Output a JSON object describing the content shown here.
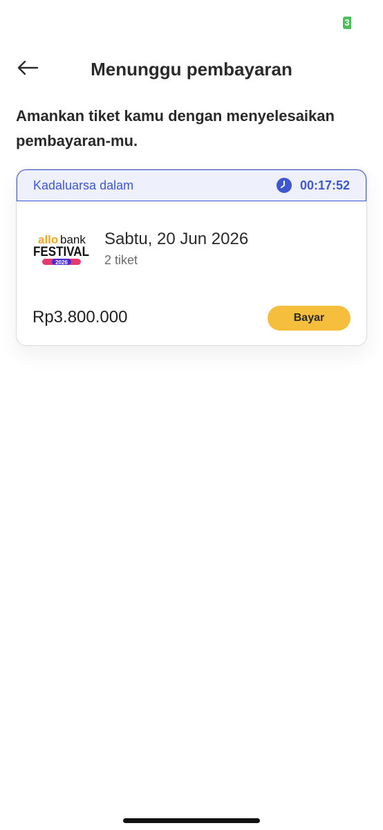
{
  "status_bar": {
    "battery_level": "3",
    "battery_color": "#4cbf5a"
  },
  "header": {
    "title": "Menunggu pembayaran",
    "back_icon": "arrow-left-icon"
  },
  "intro": {
    "text": "Amankan tiket kamu dengan menyelesaikan pembayaran-mu."
  },
  "order_card": {
    "expiry": {
      "label": "Kadaluarsa dalam",
      "countdown": "00:17:52",
      "icon": "clock-icon",
      "color": "#3e57d0"
    },
    "event": {
      "logo": {
        "line1": "allobank",
        "line2": "FESTIVAL",
        "year": "2026"
      },
      "date": "Sabtu, 20 Jun 2026",
      "ticket_count": "2 tiket"
    },
    "price": "Rp3.800.000",
    "pay_button_label": "Bayar",
    "pay_button_color": "#f5be3c"
  }
}
